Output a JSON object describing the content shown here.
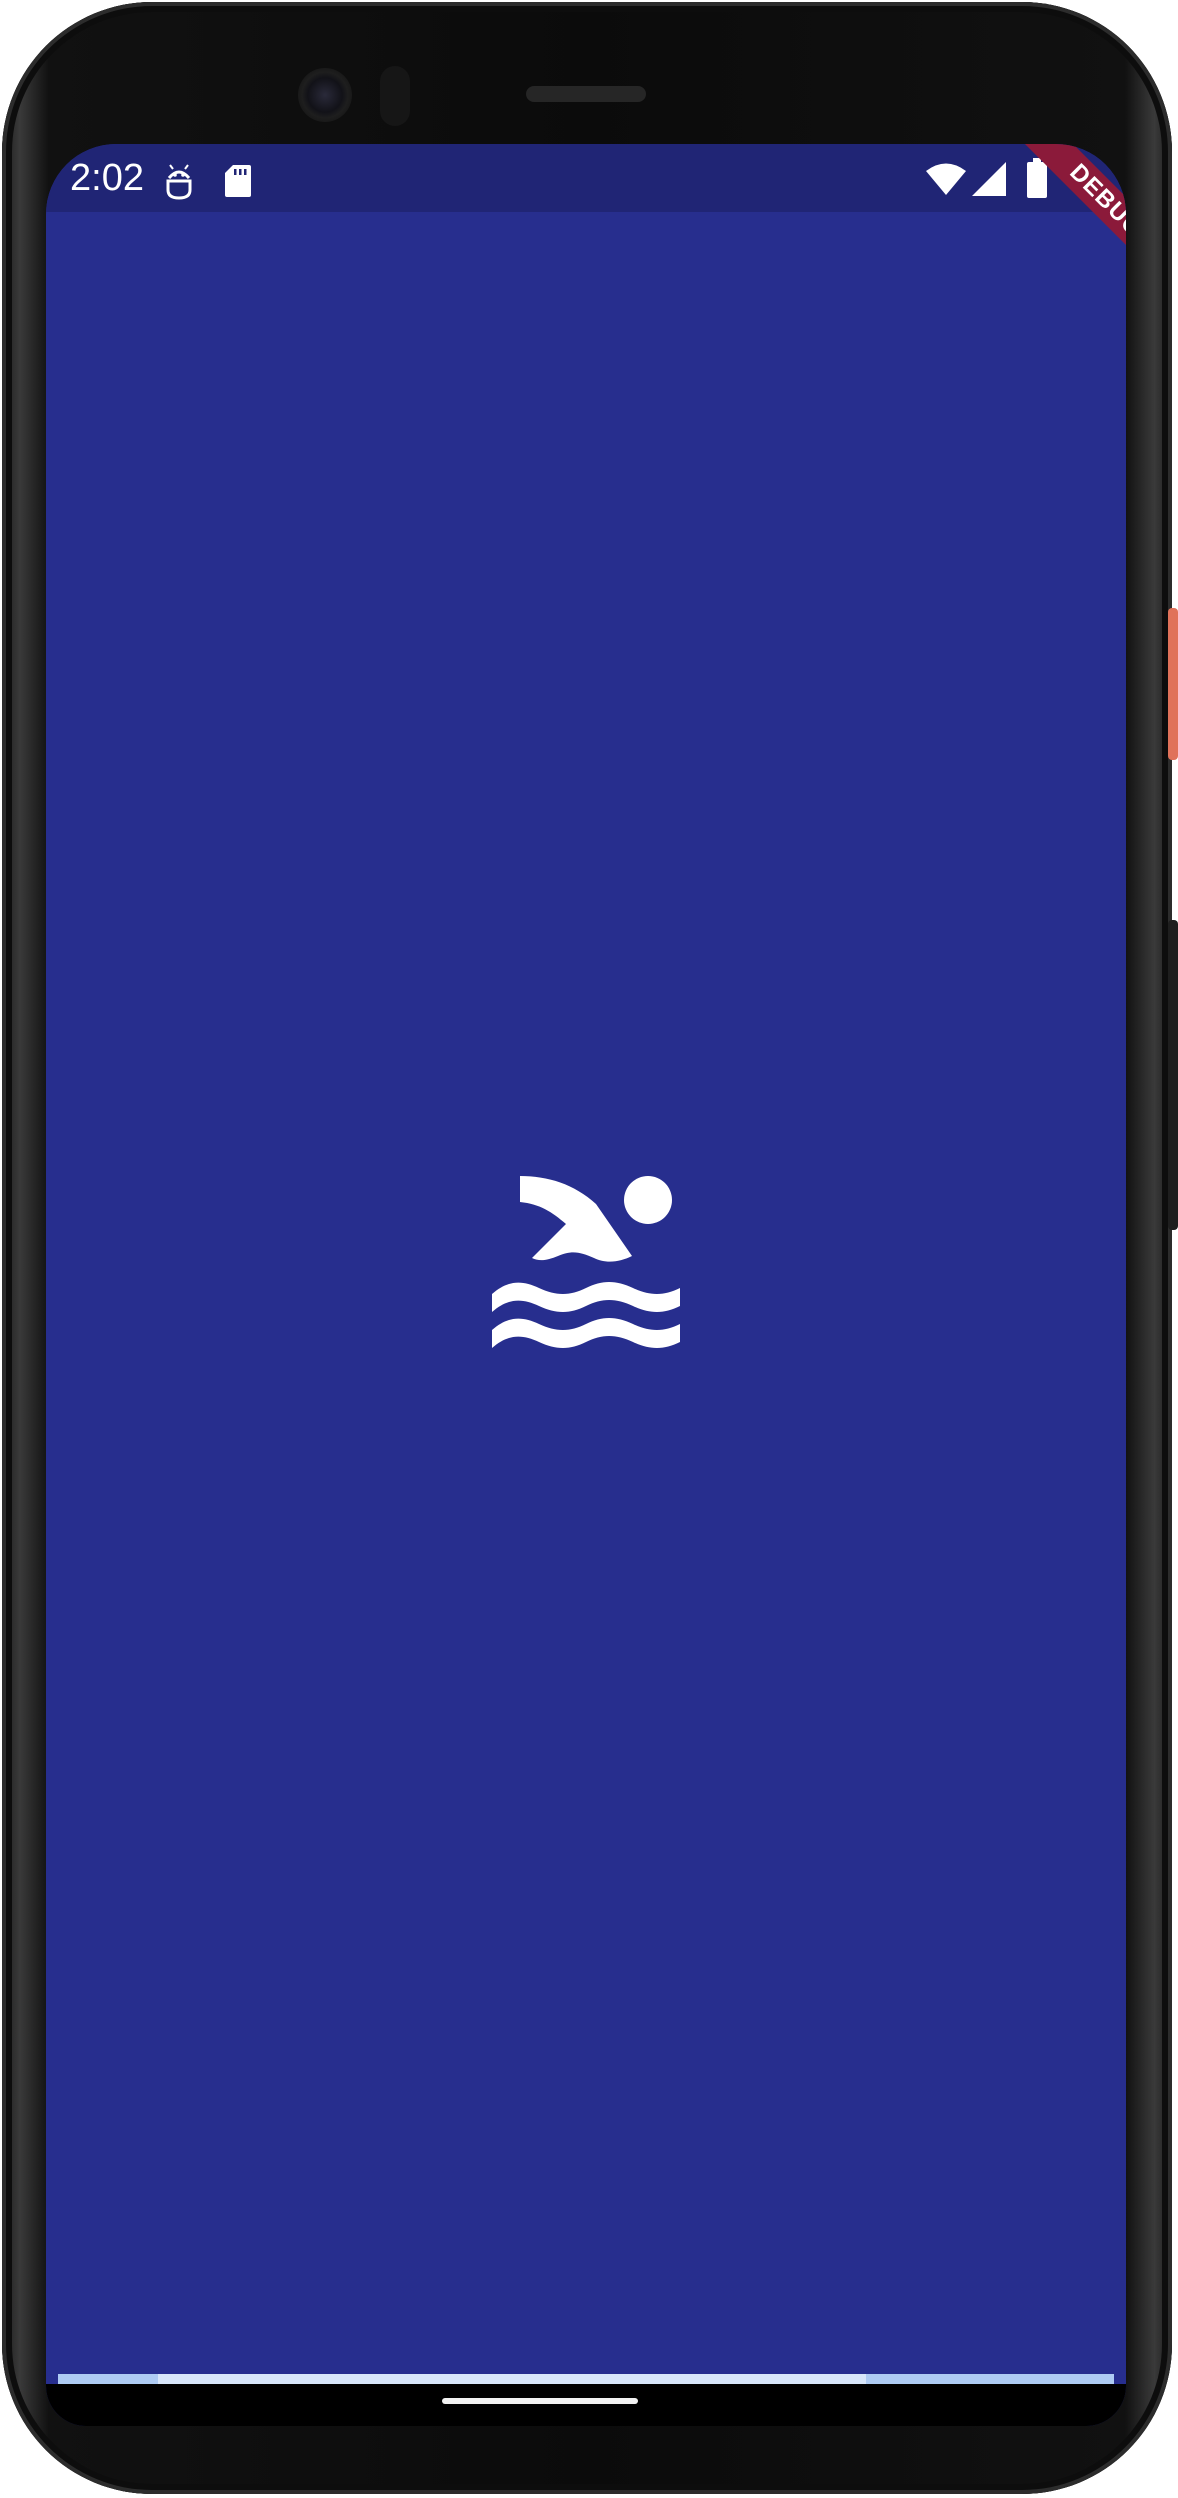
{
  "status_bar": {
    "time": "2:02",
    "left_icons": [
      "android-debug-icon",
      "sd-card-icon"
    ],
    "right_icons": [
      "wifi-icon",
      "cell-signal-icon",
      "battery-icon"
    ]
  },
  "debug_banner": {
    "label": "DEBUG"
  },
  "splash": {
    "icon": "swimming-icon",
    "background_color": "#272e8e"
  },
  "progress": {
    "fraction": 0.67
  },
  "colors": {
    "status_bar": "#202575",
    "screen": "#272e8e",
    "banner": "#8b1a3a",
    "progress_track": "#aecbf3",
    "progress_fill": "#d8e6fa"
  }
}
